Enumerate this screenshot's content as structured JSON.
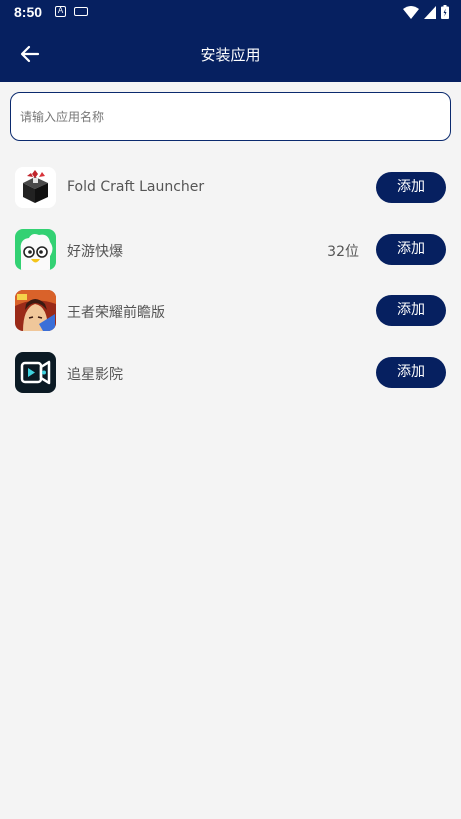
{
  "status_bar": {
    "time": "8:50",
    "notification_icons": [
      "text-a-icon",
      "keyboard-icon"
    ],
    "system_icons": [
      "wifi-icon",
      "signal-icon",
      "battery-icon"
    ]
  },
  "app_bar": {
    "title": "安装应用",
    "back_icon": "arrow-left-icon"
  },
  "search": {
    "placeholder": "请输入应用名称",
    "value": ""
  },
  "apps": [
    {
      "name": "Fold Craft Launcher",
      "meta": "",
      "button": "添加",
      "icon": "fold-craft-launcher-icon"
    },
    {
      "name": "好游快爆",
      "meta": "32位",
      "button": "添加",
      "icon": "haoyou-kuaibao-icon"
    },
    {
      "name": "王者荣耀前瞻版",
      "meta": "",
      "button": "添加",
      "icon": "honor-of-kings-preview-icon"
    },
    {
      "name": "追星影院",
      "meta": "",
      "button": "添加",
      "icon": "zhuixing-cinema-icon"
    }
  ],
  "colors": {
    "primary": "#062060",
    "background": "#f4f4f4"
  }
}
